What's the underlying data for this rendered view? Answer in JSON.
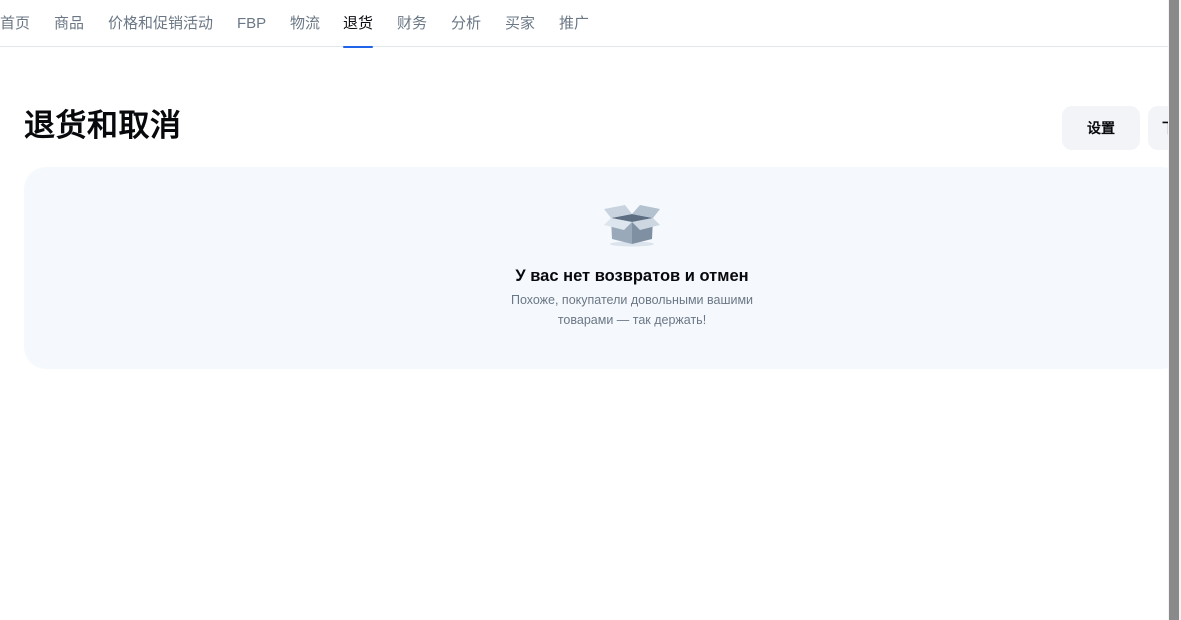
{
  "nav": {
    "items": [
      {
        "label": "首页"
      },
      {
        "label": "商品"
      },
      {
        "label": "价格和促销活动"
      },
      {
        "label": "FBP"
      },
      {
        "label": "物流"
      },
      {
        "label": "退货",
        "active": true
      },
      {
        "label": "财务"
      },
      {
        "label": "分析"
      },
      {
        "label": "买家"
      },
      {
        "label": "推广"
      }
    ],
    "accent_color": "#1f63e8"
  },
  "header": {
    "title": "退货和取消",
    "buttons": {
      "settings_label": "设置",
      "second_label": "下"
    }
  },
  "empty_state": {
    "icon": "open-box-icon",
    "title": "У вас нет возвратов и отмен",
    "subtitle_line1": "Похоже, покупатели довольными вашими",
    "subtitle_line2": "товарами — так держать!"
  }
}
